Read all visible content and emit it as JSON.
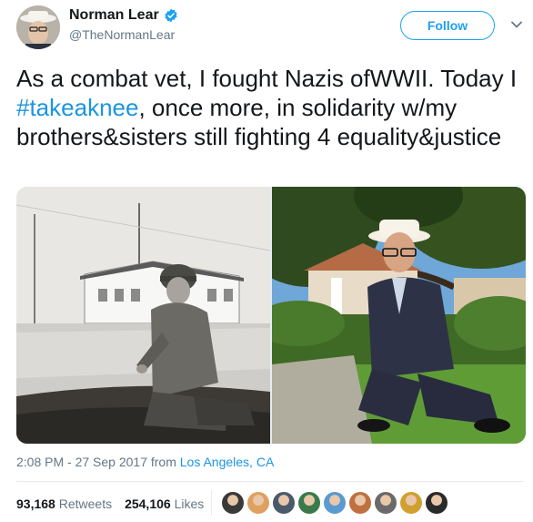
{
  "author": {
    "name": "Norman Lear",
    "handle": "@TheNormanLear",
    "avatar_icon": "hat-person-avatar",
    "verified": true
  },
  "follow_label": "Follow",
  "tweet": {
    "text_before": "As a combat vet, I fought Nazis ofWWII. Today I ",
    "hashtag": "#takeaknee",
    "text_after": ", once more, in solidarity w/my brothers&sisters still fighting 4 equality&justice"
  },
  "media": [
    {
      "description": "black and white photo soldier kneeling"
    },
    {
      "description": "color photo elderly man kneeling wearing hat"
    }
  ],
  "meta": {
    "time": "2:08 PM - 27 Sep 2017 from ",
    "location": "Los Angeles, CA"
  },
  "stats": {
    "retweets_count": "93,168",
    "retweets_label": "Retweets",
    "likes_count": "254,106",
    "likes_label": "Likes"
  },
  "likers": [
    "#3a3a3a",
    "#e0a060",
    "#4a5a6a",
    "#3a7a4a",
    "#5a9ad0",
    "#c07040",
    "#6a6a6a",
    "#d0a030",
    "#2a2a2a"
  ],
  "colors": {
    "accent": "#1da1f2",
    "link": "#1b95e0",
    "secondary": "#657786"
  }
}
